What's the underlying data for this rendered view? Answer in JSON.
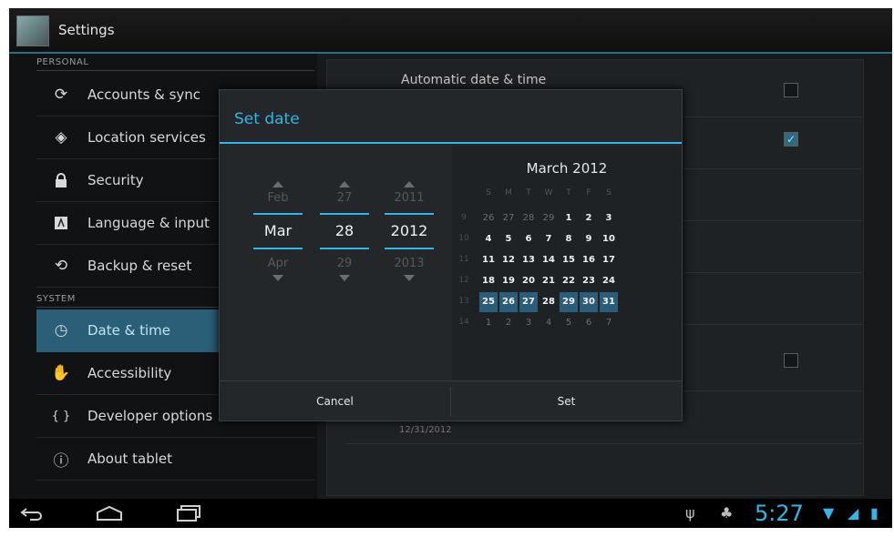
{
  "app": {
    "title": "Settings"
  },
  "sidebar": {
    "personal_header": "PERSONAL",
    "system_header": "SYSTEM",
    "personal_items": [
      {
        "label": "Accounts & sync",
        "icon": "sync-icon"
      },
      {
        "label": "Location services",
        "icon": "location-icon"
      },
      {
        "label": "Security",
        "icon": "lock-icon"
      },
      {
        "label": "Language & input",
        "icon": "keyboard-icon"
      },
      {
        "label": "Backup & reset",
        "icon": "backup-icon"
      }
    ],
    "system_items": [
      {
        "label": "Date & time",
        "icon": "clock-icon",
        "selected": true
      },
      {
        "label": "Accessibility",
        "icon": "hand-icon"
      },
      {
        "label": "Developer options",
        "icon": "braces-icon"
      },
      {
        "label": "About tablet",
        "icon": "info-icon"
      }
    ]
  },
  "main": {
    "automatic_label": "Automatic date & time",
    "automatic_checked": false,
    "second_checked": true,
    "third_checked": false,
    "date_summary": "12/31/2012"
  },
  "dialog": {
    "title": "Set date",
    "month": {
      "prev": "Feb",
      "current": "Mar",
      "next": "Apr"
    },
    "day": {
      "prev": "27",
      "current": "28",
      "next": "29"
    },
    "year": {
      "prev": "2011",
      "current": "2012",
      "next": "2013"
    },
    "calendar": {
      "header": "March 2012",
      "weekdays": [
        "S",
        "M",
        "T",
        "W",
        "T",
        "F",
        "S"
      ],
      "weeks": [
        {
          "num": "9",
          "days": [
            "26",
            "27",
            "28",
            "29",
            "1",
            "2",
            "3"
          ]
        },
        {
          "num": "10",
          "days": [
            "4",
            "5",
            "6",
            "7",
            "8",
            "9",
            "10"
          ]
        },
        {
          "num": "11",
          "days": [
            "11",
            "12",
            "13",
            "14",
            "15",
            "16",
            "17"
          ]
        },
        {
          "num": "12",
          "days": [
            "18",
            "19",
            "20",
            "21",
            "22",
            "23",
            "24"
          ]
        },
        {
          "num": "13",
          "days": [
            "25",
            "26",
            "27",
            "28",
            "29",
            "30",
            "31"
          ]
        },
        {
          "num": "14",
          "days": [
            "1",
            "2",
            "3",
            "4",
            "5",
            "6",
            "7"
          ]
        }
      ]
    },
    "cancel_label": "Cancel",
    "set_label": "Set"
  },
  "statusbar": {
    "time": "5:27"
  },
  "colors": {
    "accent": "#33b5e5",
    "selected": "#2b5f77"
  }
}
